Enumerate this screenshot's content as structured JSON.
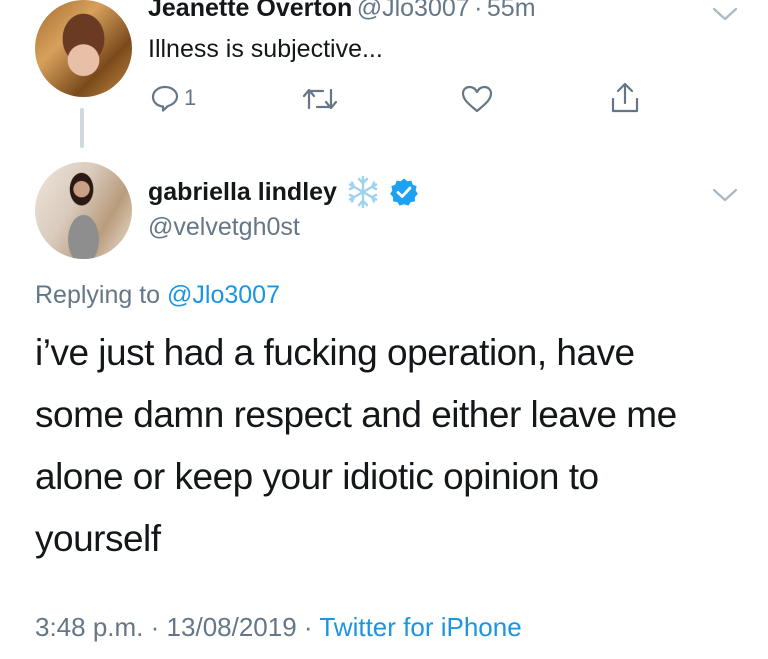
{
  "parent_tweet": {
    "author_name": "Jeanette Overton",
    "author_handle": "@Jlo3007",
    "separator": "·",
    "time_ago": "55m",
    "text": "Illness is subjective...",
    "reply_count": "1"
  },
  "main_tweet": {
    "author_name": "gabriella lindley",
    "author_handle": "@velvetgh0st",
    "replying_prefix": "Replying to",
    "replying_to": "@Jlo3007",
    "text_lines": [
      "i’ve just had a fucking operation, have",
      "some damn respect and either leave me",
      "alone or keep your idiotic opinion to",
      "yourself"
    ],
    "time": "3:48 p.m.",
    "sep1": "·",
    "date": "13/08/2019",
    "sep2": "·",
    "source": "Twitter for iPhone"
  },
  "colors": {
    "link": "#1b95e0",
    "secondary": "#657786",
    "verified": "#1da1f2",
    "snowflake": "#9ed3f0"
  },
  "icons": [
    "reply-icon",
    "retweet-icon",
    "like-icon",
    "share-icon",
    "chevron-down-icon",
    "verified-badge-icon",
    "snowflake-icon"
  ]
}
